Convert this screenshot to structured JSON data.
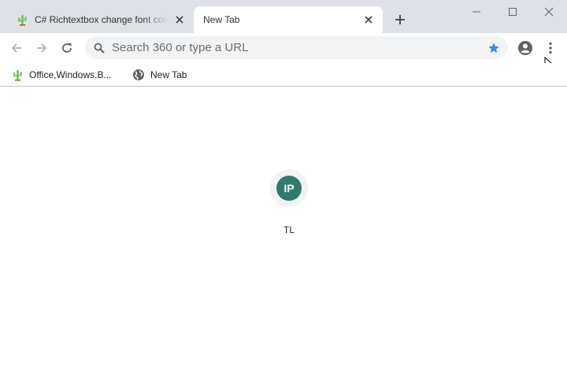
{
  "tabs": [
    {
      "title": "C# Richtextbox change font color",
      "active": false
    },
    {
      "title": "New Tab",
      "active": true
    }
  ],
  "omnibox": {
    "placeholder": "Search 360 or type a URL",
    "value": ""
  },
  "bookmarks": [
    {
      "label": "Office,Windows,B..."
    },
    {
      "label": "New Tab"
    }
  ],
  "shortcut": {
    "avatar_text": "IP",
    "label": "TL"
  },
  "colors": {
    "titlebar_bg": "#dee1e6",
    "star_accent": "#4285f4",
    "avatar_bg": "#2f7a6c",
    "icon_gray": "#5f6368"
  },
  "icons": {
    "favicon": "cactus-icon",
    "globe": "globe-icon",
    "star": "star-icon",
    "profile": "account-circle-icon",
    "menu": "more-vert-icon"
  }
}
